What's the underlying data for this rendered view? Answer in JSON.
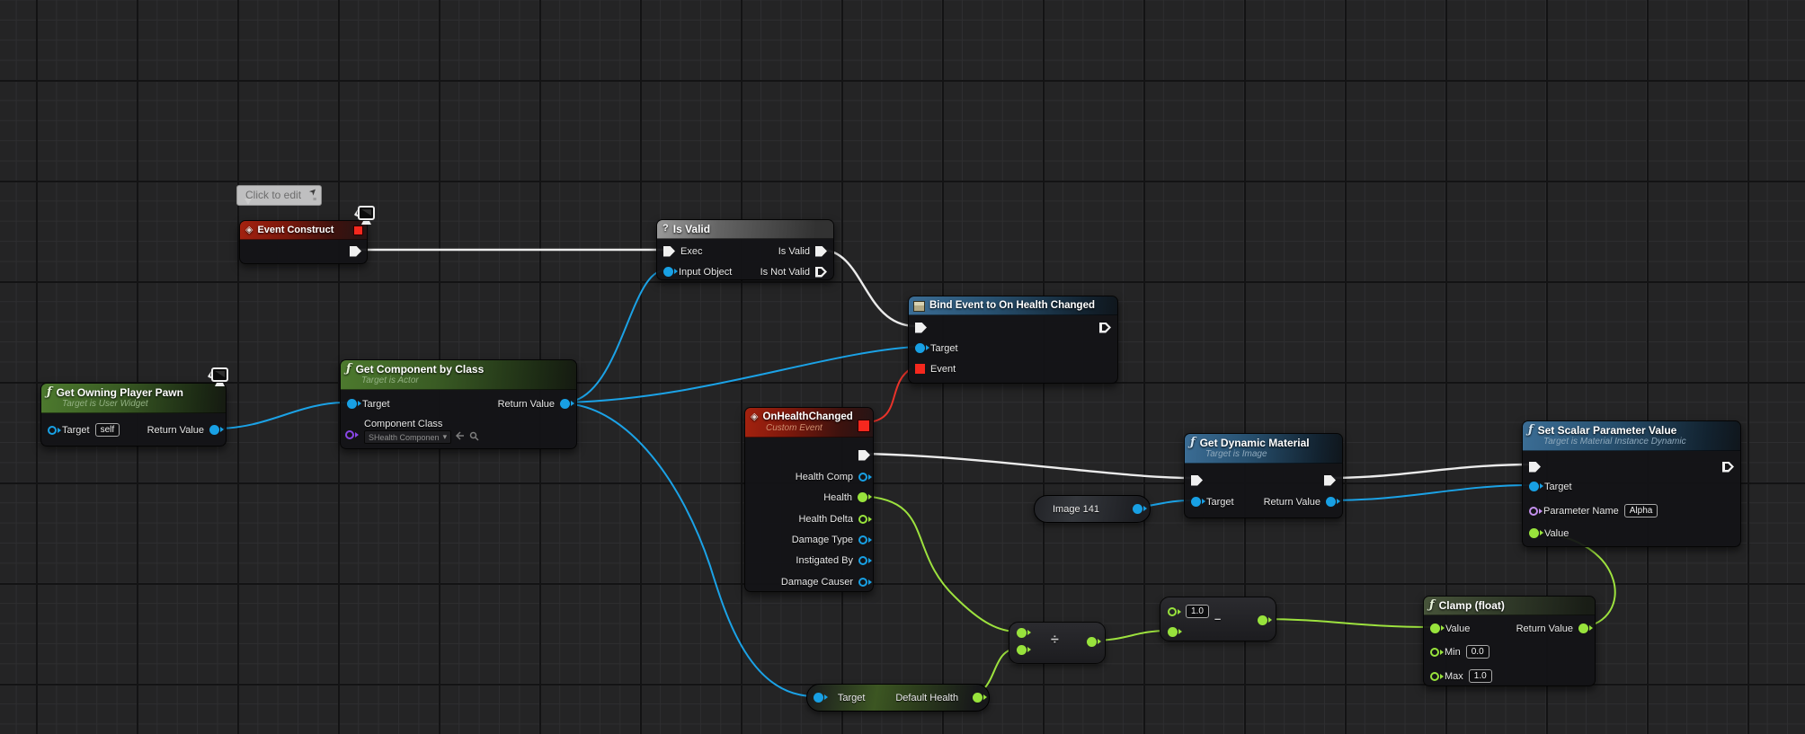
{
  "colors": {
    "exec_wire": "#ececec",
    "object": "#18a0e4",
    "float": "#98e33c",
    "delegate": "#f5281e",
    "class": "#8a46e8",
    "name": "#c490ee"
  },
  "icons": {
    "function": "ƒ",
    "event": "◈",
    "question": "?",
    "divide": "÷",
    "subtract": "–",
    "caret": "▾",
    "comment_pin": "➤",
    "grip": "≡"
  },
  "comment": {
    "text": "Click to edit"
  },
  "nodes": {
    "event_construct": {
      "title": "Event Construct"
    },
    "is_valid": {
      "title": "Is Valid",
      "pin_exec": "Exec",
      "pin_input_object": "Input Object",
      "pin_is_valid": "Is Valid",
      "pin_is_not_valid": "Is Not Valid"
    },
    "bind_event": {
      "title": "Bind Event to On Health Changed",
      "pin_target": "Target",
      "pin_event": "Event"
    },
    "get_owning_player_pawn": {
      "title": "Get Owning Player Pawn",
      "subtitle": "Target is User Widget",
      "pin_target": "Target",
      "target_value": "self",
      "pin_return": "Return Value"
    },
    "get_component_by_class": {
      "title": "Get Component by Class",
      "subtitle": "Target is Actor",
      "pin_target": "Target",
      "pin_return": "Return Value",
      "pin_component_class": "Component Class",
      "component_class_value": "SHealth Componen"
    },
    "on_health_changed": {
      "title": "OnHealthChanged",
      "subtitle": "Custom Event",
      "pins": [
        "Health Comp",
        "Health",
        "Health Delta",
        "Damage Type",
        "Instigated By",
        "Damage Causer"
      ]
    },
    "image_141": {
      "title": "Image 141"
    },
    "get_dynamic_material": {
      "title": "Get Dynamic Material",
      "subtitle": "Target is Image",
      "pin_target": "Target",
      "pin_return": "Return Value"
    },
    "set_scalar_parameter_value": {
      "title": "Set Scalar Parameter Value",
      "subtitle": "Target is Material Instance Dynamic",
      "pin_target": "Target",
      "pin_parameter_name": "Parameter Name",
      "parameter_name_value": "Alpha",
      "pin_value": "Value"
    },
    "clamp_float": {
      "title": "Clamp (float)",
      "pin_value": "Value",
      "pin_return": "Return Value",
      "pin_min": "Min",
      "min_value": "0.0",
      "pin_max": "Max",
      "max_value": "1.0"
    },
    "divide": {},
    "subtract": {
      "value": "1.0"
    },
    "default_health": {
      "pin_target": "Target",
      "pin_output": "Default Health"
    }
  }
}
